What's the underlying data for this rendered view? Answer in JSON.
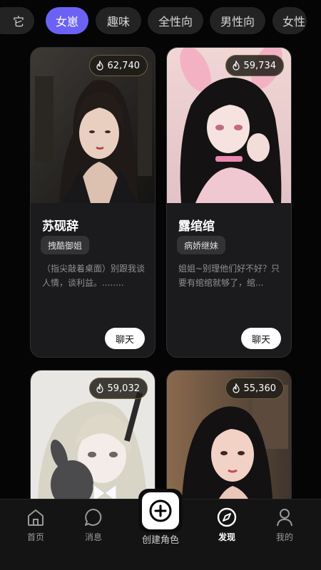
{
  "tabs": [
    {
      "label": "它",
      "active": false
    },
    {
      "label": "女崽",
      "active": true
    },
    {
      "label": "趣味",
      "active": false
    },
    {
      "label": "全性向",
      "active": false
    },
    {
      "label": "男性向",
      "active": false
    },
    {
      "label": "女性",
      "active": false
    }
  ],
  "cards": [
    {
      "popularity": "62,740",
      "name": "苏砚辞",
      "tag": "拽酷御姐",
      "desc": "（指尖敲着桌面）别跟我谈人情，谈利益。........",
      "chat": "聊天"
    },
    {
      "popularity": "59,734",
      "name": "露绾绾",
      "tag": "病娇继妹",
      "desc": "姐姐~别理他们好不好？只要有绾绾就够了，绾...",
      "chat": "聊天"
    },
    {
      "popularity": "59,032"
    },
    {
      "popularity": "55,360"
    }
  ],
  "nav": {
    "home": "首页",
    "messages": "消息",
    "create": "创建角色",
    "discover": "发现",
    "mine": "我的"
  },
  "colors": {
    "accent": "#6b62f5",
    "background": "#050505",
    "card": "#1b1b1d"
  }
}
